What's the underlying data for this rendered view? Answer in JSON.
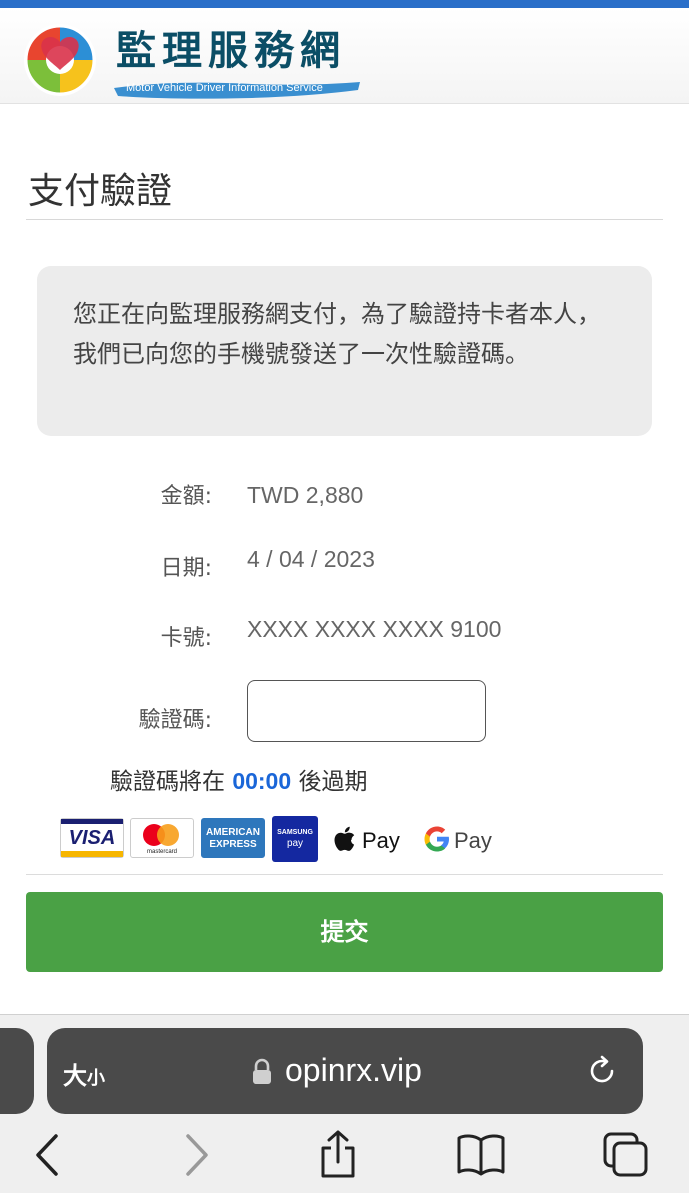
{
  "header": {
    "title": "監理服務網",
    "subtitle": "Motor Vehicle Driver Information Service"
  },
  "page_title": "支付驗證",
  "notice": "您正在向監理服務網支付，為了驗證持卡者本人，我們已向您的手機號發送了一次性驗證碼。",
  "details": {
    "amount_label": "金額:",
    "amount_value": "TWD 2,880",
    "date_label": "日期:",
    "date_value": "4 / 04 / 2023",
    "card_label": "卡號:",
    "card_value": "XXXX XXXX XXXX 9100",
    "otp_label": "驗證碼:",
    "otp_value": ""
  },
  "expire": {
    "prefix": "驗證碼將在",
    "timer": "00:00",
    "suffix": "後過期"
  },
  "payment_methods": {
    "visa": "VISA",
    "mastercard": "mastercard",
    "amex_line1": "AMERICAN",
    "amex_line2": "EXPRESS",
    "samsung_line1": "SAMSUNG",
    "samsung_line2": "pay",
    "apple_pay": "Pay",
    "google_pay": "Pay"
  },
  "submit_label": "提交",
  "browser": {
    "text_size": "大",
    "text_size_small": "小",
    "url": "opinrx.vip",
    "icons": [
      "lock-icon",
      "reload-icon",
      "back-icon",
      "forward-icon",
      "share-icon",
      "bookmarks-icon",
      "tabs-icon"
    ]
  },
  "colors": {
    "submit_green": "#4aa145",
    "timer_blue": "#1a66d8",
    "header_border": "#2a6fc9",
    "address_bar": "#4a4a4a"
  }
}
